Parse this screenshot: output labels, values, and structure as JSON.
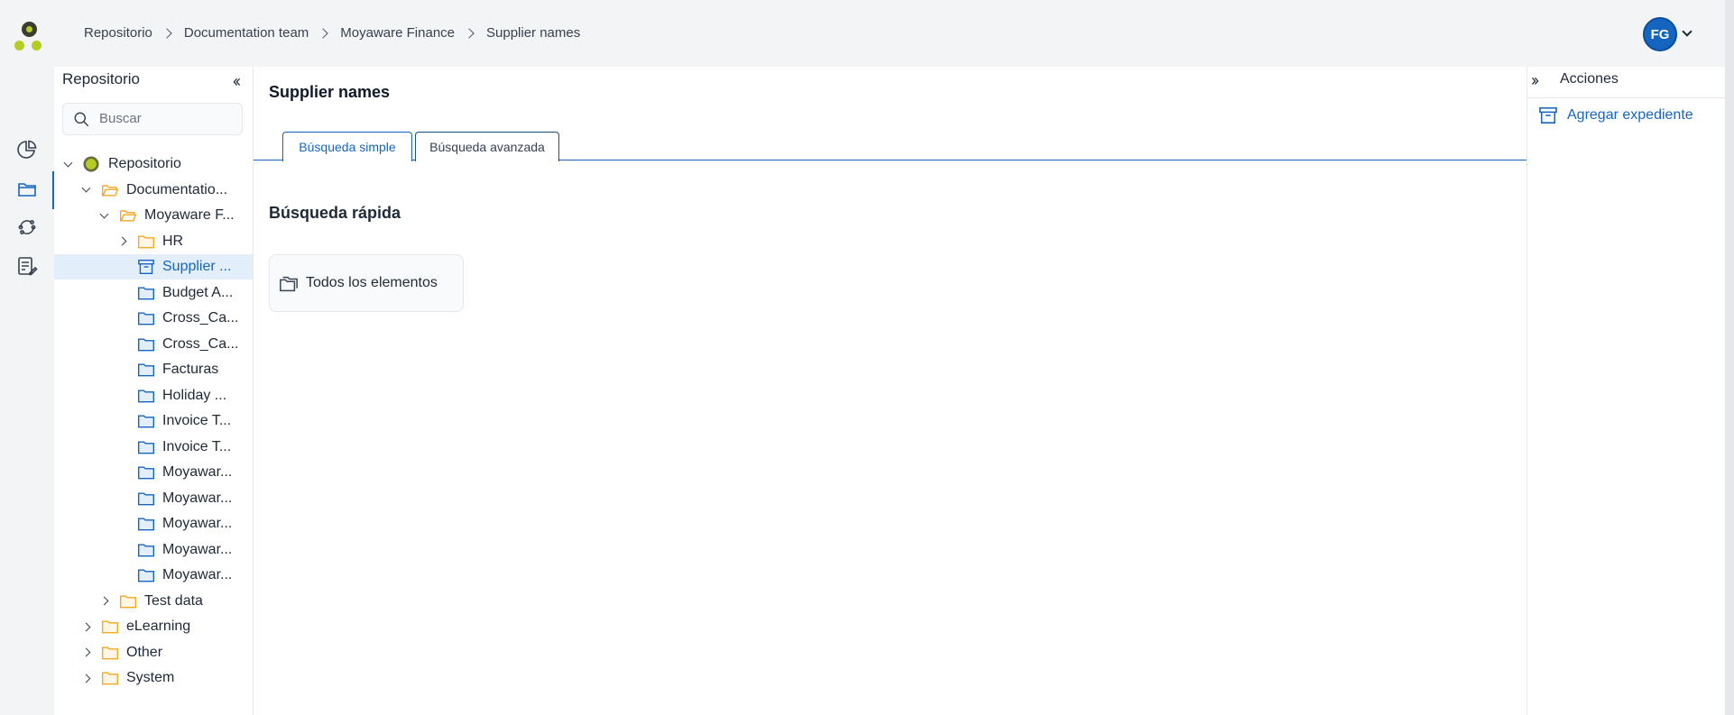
{
  "header": {
    "breadcrumb": [
      "Repositorio",
      "Documentation team",
      "Moyaware Finance",
      "Supplier names"
    ],
    "user_initials": "FG"
  },
  "colors": {
    "accent": "#1565c0",
    "folder_yellow": "#f5a623",
    "folder_blue": "#1565c0",
    "logo_green": "#b5cc24"
  },
  "rail": [
    "dashboard-icon",
    "folders-icon",
    "sync-icon",
    "tasks-icon"
  ],
  "tree_panel": {
    "title": "Repositorio",
    "search_placeholder": "Buscar",
    "nodes": [
      {
        "label": "Repositorio",
        "icon": "repository-icon"
      },
      {
        "label": "Documentatio...",
        "icon": "folder-open-icon"
      },
      {
        "label": "Moyaware F...",
        "icon": "folder-open-icon"
      },
      {
        "label": "HR",
        "icon": "folder-icon"
      },
      {
        "label": "Supplier ...",
        "icon": "archive-box-icon"
      },
      {
        "label": "Budget A...",
        "icon": "folder-icon"
      },
      {
        "label": "Cross_Ca...",
        "icon": "folder-icon"
      },
      {
        "label": "Cross_Ca...",
        "icon": "folder-icon"
      },
      {
        "label": "Facturas",
        "icon": "folder-icon"
      },
      {
        "label": "Holiday ...",
        "icon": "folder-icon"
      },
      {
        "label": "Invoice T...",
        "icon": "folder-icon"
      },
      {
        "label": "Invoice T...",
        "icon": "folder-icon"
      },
      {
        "label": "Moyawar...",
        "icon": "folder-icon"
      },
      {
        "label": "Moyawar...",
        "icon": "folder-icon"
      },
      {
        "label": "Moyawar...",
        "icon": "folder-icon"
      },
      {
        "label": "Moyawar...",
        "icon": "folder-icon"
      },
      {
        "label": "Moyawar...",
        "icon": "folder-icon"
      },
      {
        "label": "Test data",
        "icon": "folder-icon"
      },
      {
        "label": "eLearning",
        "icon": "folder-icon"
      },
      {
        "label": "Other",
        "icon": "folder-icon"
      },
      {
        "label": "System",
        "icon": "folder-icon"
      }
    ]
  },
  "main": {
    "title": "Supplier names",
    "tabs": [
      "Búsqueda simple",
      "Búsqueda avanzada"
    ],
    "active_tab": "Búsqueda simple",
    "section_title": "Búsqueda rápida",
    "quick_card": "Todos los elementos"
  },
  "actions_panel": {
    "title": "Acciones",
    "items": [
      "Agregar expediente"
    ]
  }
}
